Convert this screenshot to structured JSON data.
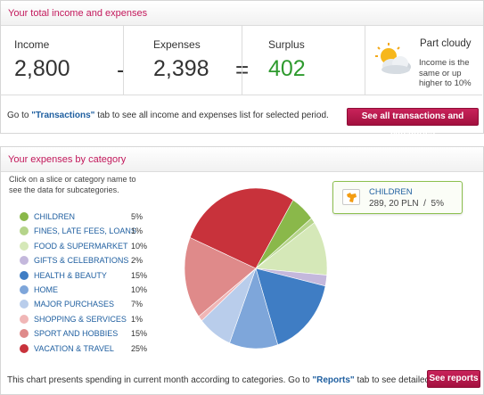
{
  "summary": {
    "title": "Your total income and expenses",
    "income": {
      "label": "Income",
      "value": "2,800"
    },
    "minus_sign": "-",
    "expenses": {
      "label": "Expenses",
      "value": "2,398"
    },
    "equals_sign": "=",
    "surplus": {
      "label": "Surplus",
      "value": "402",
      "color": "#2e9a2e"
    },
    "weather": {
      "icon": "partly-cloudy-icon",
      "title": "Part cloudy",
      "description": "Income is the same or up higher to 10%"
    },
    "footer": {
      "prefix": "Go to ",
      "link": "\"Transactions\"",
      "suffix": " tab to see all income and expenses list for selected period."
    },
    "button_label": "See all transactions and categories"
  },
  "expenses": {
    "title": "Your expenses by category",
    "hint": "Click on a slice or category name to see the data for subcategories.",
    "categories": [
      {
        "name": "CHILDREN",
        "percent": "5%",
        "value": 5,
        "color": "#8ab84a"
      },
      {
        "name": "FINES, LATE FEES, LOANS",
        "percent": "1%",
        "value": 1,
        "color": "#b5d48a"
      },
      {
        "name": "FOOD & SUPERMARKET",
        "percent": "10%",
        "value": 10,
        "color": "#d5e8b8"
      },
      {
        "name": "GIFTS & CELEBRATIONS",
        "percent": "2%",
        "value": 2,
        "color": "#c4b8dc"
      },
      {
        "name": "HEALTH & BEAUTY",
        "percent": "15%",
        "value": 15,
        "color": "#3f7dc4"
      },
      {
        "name": "HOME",
        "percent": "10%",
        "value": 10,
        "color": "#7ea6da"
      },
      {
        "name": "MAJOR PURCHASES",
        "percent": "7%",
        "value": 7,
        "color": "#b9cdeb"
      },
      {
        "name": "SHOPPING & SERVICES",
        "percent": "1%",
        "value": 1,
        "color": "#f0b6b6"
      },
      {
        "name": "SPORT AND HOBBIES",
        "percent": "15%",
        "value": 15,
        "color": "#df8a8a"
      },
      {
        "name": "VACATION & TRAVEL",
        "percent": "25%",
        "value": 25,
        "color": "#c8323b"
      }
    ],
    "tooltip": {
      "category": "CHILDREN",
      "amount": "289, 20 PLN",
      "separator": "/",
      "percent": "5%"
    },
    "footer": {
      "prefix": "This chart presents spending in current month according to categories. Go to ",
      "link": "\"Reports\"",
      "suffix": " tab to see detailed reports."
    },
    "button_label": "See reports"
  }
}
